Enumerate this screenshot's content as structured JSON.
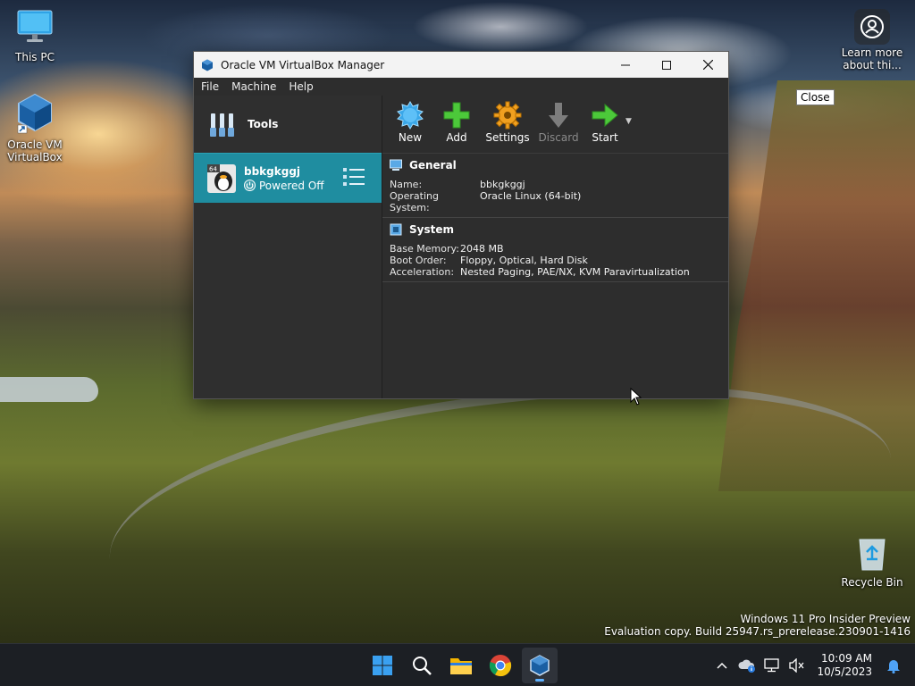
{
  "desktop": {
    "icons": {
      "this_pc": "This PC",
      "virtualbox": "Oracle VM VirtualBox",
      "recycle_bin": "Recycle Bin",
      "learn_more": "Learn more about thi..."
    },
    "tooltip": "Close",
    "watermark": {
      "line1": "Windows 11 Pro Insider Preview",
      "line2": "Evaluation copy. Build 25947.rs_prerelease.230901-1416"
    }
  },
  "window": {
    "title": "Oracle VM VirtualBox Manager",
    "controls": {
      "minimize": "—",
      "maximize": "☐",
      "close": "✕"
    },
    "menu": [
      "File",
      "Machine",
      "Help"
    ]
  },
  "sidebar": {
    "tools_label": "Tools",
    "vm": {
      "name": "bbkgkggj",
      "state": "Powered Off",
      "os_badge": "64"
    }
  },
  "toolbar": {
    "new": "New",
    "add": "Add",
    "settings": "Settings",
    "discard": "Discard",
    "start": "Start"
  },
  "details": {
    "general": {
      "title": "General",
      "rows": [
        {
          "k": "Name:",
          "v": "bbkgkggj"
        },
        {
          "k": "Operating System:",
          "v": "Oracle Linux (64-bit)"
        }
      ]
    },
    "system": {
      "title": "System",
      "rows": [
        {
          "k": "Base Memory:",
          "v": "2048 MB"
        },
        {
          "k": "Boot Order:",
          "v": "Floppy, Optical, Hard Disk"
        },
        {
          "k": "Acceleration:",
          "v": "Nested Paging, PAE/NX, KVM Paravirtualization"
        }
      ]
    }
  },
  "taskbar": {
    "apps": [
      "start-icon",
      "search-icon",
      "file-explorer-icon",
      "chrome-icon",
      "virtualbox-icon"
    ],
    "clock": {
      "time": "10:09 AM",
      "date": "10/5/2023"
    }
  },
  "colors": {
    "vm_selected": "#1f8da0",
    "window_bg": "#2d2d2d",
    "titlebar_bg": "#f3f3f3",
    "taskbar_bg": "#1c1f24"
  }
}
